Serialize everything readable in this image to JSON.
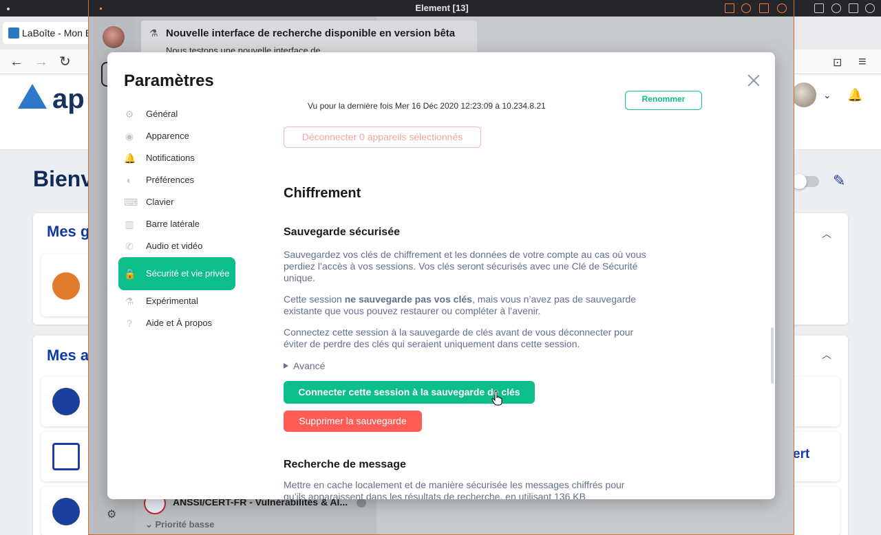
{
  "os": {
    "window_title": "Element [13]"
  },
  "browser": {
    "tab_title": "LaBoîte - Mon E",
    "nav": {
      "back": "←",
      "forward": "→",
      "reload": "↻",
      "pocket": "⊡",
      "menu": "≡"
    }
  },
  "app": {
    "logo_text": "ap",
    "welcome": "Bienv",
    "card1_title": "Mes g",
    "card2_title": "Mes a",
    "cert_fragment": "ert"
  },
  "element": {
    "beta_title": "Nouvelle interface de recherche disponible en version bêta",
    "beta_sub": "Nous testons une nouvelle interface de",
    "room_name": "ANSSI/CERT-FR - Vulnérabilités & Al...",
    "priority_label": "Priorité basse"
  },
  "dialog": {
    "title": "Paramètres",
    "nav": [
      {
        "label": "Général",
        "icon": "gear-icon",
        "glyph": "⚙"
      },
      {
        "label": "Apparence",
        "icon": "eye-icon",
        "glyph": "◉"
      },
      {
        "label": "Notifications",
        "icon": "bell-icon",
        "glyph": "🔔"
      },
      {
        "label": "Préférences",
        "icon": "toggle-icon",
        "glyph": "◐"
      },
      {
        "label": "Clavier",
        "icon": "keyboard-icon",
        "glyph": "⌨"
      },
      {
        "label": "Barre latérale",
        "icon": "sidebar-icon",
        "glyph": "▥"
      },
      {
        "label": "Audio et vidéo",
        "icon": "phone-icon",
        "glyph": "✆"
      },
      {
        "label": "Sécurité et vie privée",
        "icon": "lock-icon",
        "glyph": "🔒"
      },
      {
        "label": "Expérimental",
        "icon": "flask-icon",
        "glyph": "⚗"
      },
      {
        "label": "Aide et À propos",
        "icon": "help-icon",
        "glyph": "?"
      }
    ],
    "session_last_seen": "Vu pour la dernière fois Mer 16 Déc 2020 12:23:09 à 10.234.8.21",
    "rename_button": "Renommer",
    "disconnect_button": "Déconnecter 0 appareils sélectionnés",
    "encryption_heading": "Chiffrement",
    "backup_heading": "Sauvegarde sécurisée",
    "backup_para1": "Sauvegardez vos clés de chiffrement et les données de votre compte au cas où vous perdiez l’accès à vos sessions. Vos clés seront sécurisés avec une Clé de Sécurité unique.",
    "backup_para2_pre": "Cette session ",
    "backup_para2_bold": "ne sauvegarde pas vos clés",
    "backup_para2_post": ", mais vous n’avez pas de sauvegarde existante que vous pouvez restaurer ou compléter à l’avenir.",
    "backup_para3": "Connectez cette session à la sauvegarde de clés avant de vous déconnecter pour éviter de perdre des clés qui seraient uniquement dans cette session.",
    "advanced_label": "Avancé",
    "connect_button": "Connecter cette session à la sauvegarde de clés",
    "delete_button": "Supprimer la sauvegarde",
    "search_heading": "Recherche de message",
    "search_para": "Mettre en cache localement et de manière sécurisée les messages chiffrés pour qu’ils apparaissent dans les résultats de recherche, en utilisant 136 KB"
  }
}
